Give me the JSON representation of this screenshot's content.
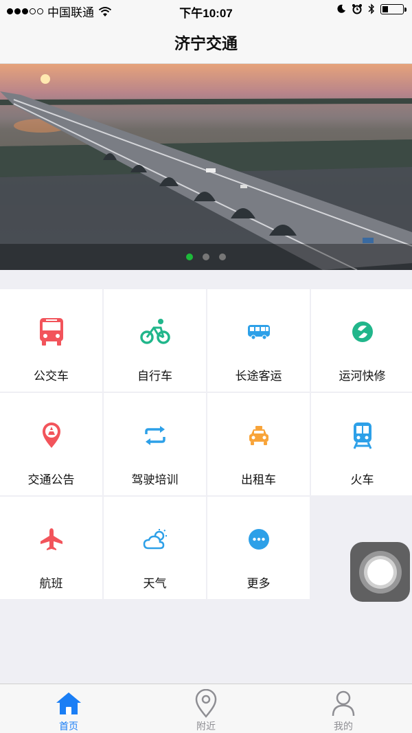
{
  "status_bar": {
    "carrier": "中国联通",
    "time": "下午10:07"
  },
  "nav": {
    "title": "济宁交通"
  },
  "banner": {
    "page_count": 3,
    "active_page": 1
  },
  "grid": {
    "items": [
      {
        "label": "公交车",
        "icon": "bus-icon",
        "color": "#f2545b"
      },
      {
        "label": "自行车",
        "icon": "bicycle-icon",
        "color": "#21b68b"
      },
      {
        "label": "长途客运",
        "icon": "coach-icon",
        "color": "#2da0e8"
      },
      {
        "label": "运河快修",
        "icon": "repair-icon",
        "color": "#21b68b"
      },
      {
        "label": "交通公告",
        "icon": "announcement-pin-icon",
        "color": "#f2545b"
      },
      {
        "label": "驾驶培训",
        "icon": "swap-arrows-icon",
        "color": "#2da0e8"
      },
      {
        "label": "出租车",
        "icon": "taxi-icon",
        "color": "#f8a43a"
      },
      {
        "label": "火车",
        "icon": "train-icon",
        "color": "#2da0e8"
      },
      {
        "label": "航班",
        "icon": "airplane-icon",
        "color": "#f2545b"
      },
      {
        "label": "天气",
        "icon": "weather-icon",
        "color": "#2da0e8"
      },
      {
        "label": "更多",
        "icon": "more-icon",
        "color": "#2da0e8"
      }
    ]
  },
  "tabs": [
    {
      "label": "首页",
      "icon": "home-icon",
      "active": true
    },
    {
      "label": "附近",
      "icon": "location-pin-icon",
      "active": false
    },
    {
      "label": "我的",
      "icon": "person-icon",
      "active": false
    }
  ],
  "colors": {
    "accent": "#1a7ef5",
    "active_dot": "#1db93a"
  }
}
